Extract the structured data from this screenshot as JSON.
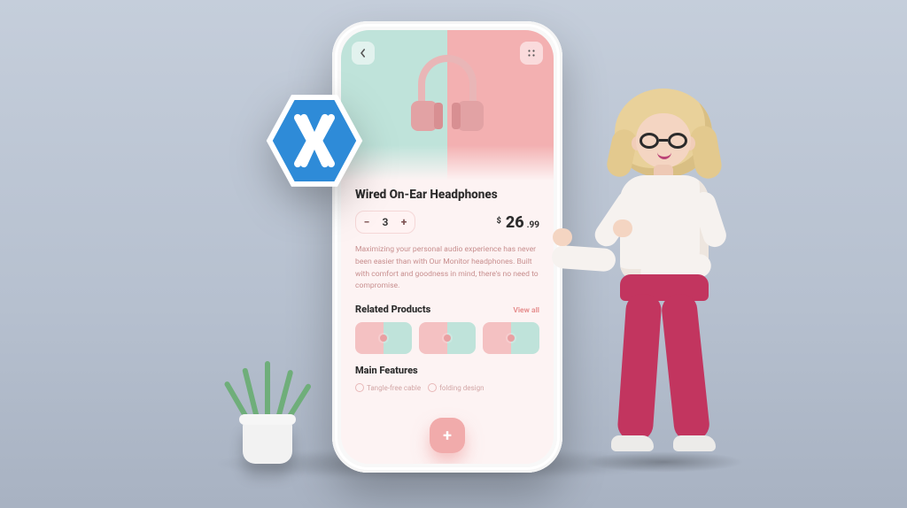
{
  "app": {
    "topbar": {
      "back_icon": "chevron-left",
      "menu_icon": "grid-menu"
    },
    "product": {
      "title": "Wired On-Ear Headphones",
      "quantity": "3",
      "currency": "$",
      "price_whole": "26",
      "price_fraction": ".99",
      "description": "Maximizing your personal audio experience has never been easier than with Our Monitor headphones. Built with comfort and goodness in mind, there's no need to compromise."
    },
    "related": {
      "heading": "Related Products",
      "view_all": "View all"
    },
    "features": {
      "heading": "Main Features",
      "items": [
        "Tangle-free cable",
        "folding design"
      ]
    },
    "fab_label": "+"
  },
  "decorations": {
    "badge": "xamarin-logo",
    "character": "presenter-3d-woman",
    "plant": "potted-plant"
  }
}
